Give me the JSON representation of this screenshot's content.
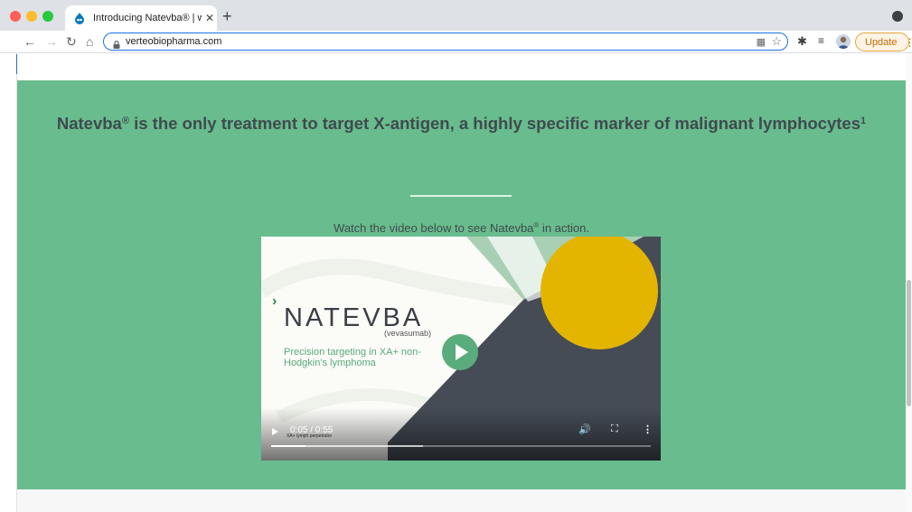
{
  "browser": {
    "tab": {
      "title": "Introducing Natevba® | wwwde",
      "favicon": "drupal-drop-icon",
      "close": "✕"
    },
    "new_tab": "+",
    "url": "verteobiopharma.com",
    "update_label": "Update",
    "icons": [
      "back-icon",
      "forward-icon",
      "reload-icon",
      "home-icon",
      "lock-icon",
      "qr-code-icon",
      "star-icon",
      "extensions-icon",
      "reading-list-icon",
      "avatar",
      "kebab-menu-icon"
    ]
  },
  "hero": {
    "headline_part1": "Natevba",
    "headline_reg": "®",
    "headline_part2": " is the only treatment to target X-antigen, a highly specific marker of malignant lymphocytes",
    "headline_ref": "1",
    "subline_part1": "Watch the video below to see Natevba",
    "subline_reg": "®",
    "subline_part2": " in action.",
    "background_color": "#69bc8d"
  },
  "video": {
    "brand_chevron": "›",
    "brand_name": "NATEVBA",
    "brand_generic": "(vevasumab)",
    "tagline": "Precision targeting in XA+ non-Hodgkin's lymphoma",
    "time_display": "0:05 / 0:55",
    "caption_text": "XA+ lymph perpetrator",
    "played_fraction": 0.091,
    "buffered_fraction": 0.4,
    "colors": {
      "dark_shape": "#454c55",
      "yellow_circle": "#e3b400",
      "green_play": "#5aac7c",
      "light_green": "#a9cfb4"
    }
  }
}
